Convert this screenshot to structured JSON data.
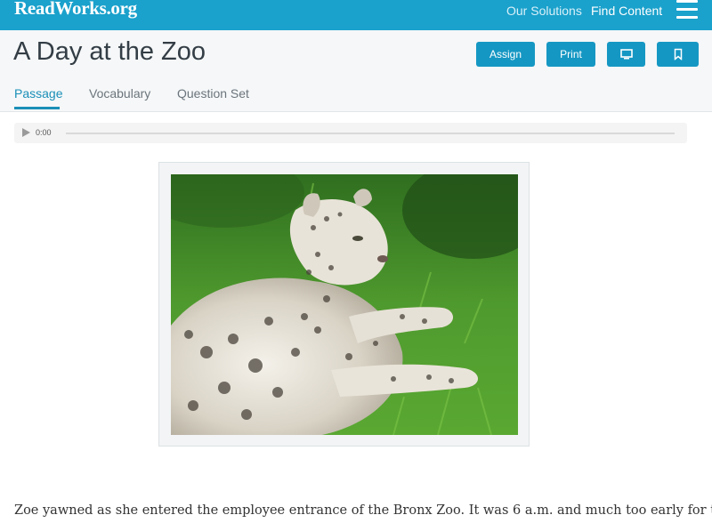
{
  "nav": {
    "logo_main": "ReadWorks",
    "logo_suffix": ".org",
    "links": [
      "Our Solutions",
      "Find Content"
    ]
  },
  "header": {
    "title": "A Day at the Zoo",
    "buttons": {
      "assign": "Assign",
      "print": "Print"
    },
    "tabs": [
      "Passage",
      "Vocabulary",
      "Question Set"
    ],
    "active_tab": "Passage"
  },
  "audio": {
    "time": "0:00",
    "progress": 0
  },
  "figure": {
    "image_icon": "snow-leopard-photo"
  },
  "passage": {
    "first_line": "Zoe yawned as she entered the employee entrance of the Bronx Zoo. It was 6 a.m. and much too early for the"
  },
  "colors": {
    "brand": "#1aa1cc",
    "button": "#1597c3",
    "active_tab": "#1a8fb8"
  }
}
